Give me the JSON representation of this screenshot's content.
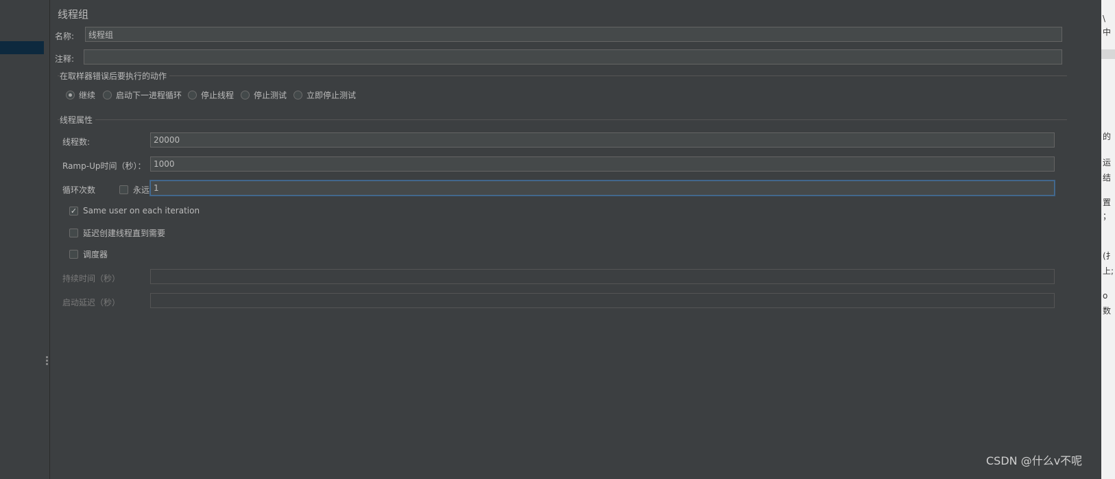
{
  "panel_title": "线程组",
  "name_field": {
    "label": "名称:",
    "value": "线程组"
  },
  "comment_field": {
    "label": "注释:",
    "value": ""
  },
  "error_action": {
    "title": "在取样器错误后要执行的动作",
    "options": [
      {
        "label": "继续",
        "selected": true
      },
      {
        "label": "启动下一进程循环",
        "selected": false
      },
      {
        "label": "停止线程",
        "selected": false
      },
      {
        "label": "停止测试",
        "selected": false
      },
      {
        "label": "立即停止测试",
        "selected": false
      }
    ]
  },
  "thread_props": {
    "title": "线程属性",
    "threads": {
      "label": "线程数:",
      "value": "20000"
    },
    "rampup": {
      "label": "Ramp-Up时间（秒）：",
      "value": "1000"
    },
    "loop": {
      "label": "循环次数",
      "forever_label": "永远",
      "forever_checked": false,
      "value": "1"
    },
    "same_user": {
      "label": "Same user on each iteration",
      "checked": true
    },
    "delay_create": {
      "label": "延迟创建线程直到需要",
      "checked": false
    },
    "scheduler": {
      "label": "调度器",
      "checked": false
    },
    "duration": {
      "label": "持续时间（秒）",
      "value": ""
    },
    "startup_delay": {
      "label": "启动延迟（秒）",
      "value": ""
    }
  },
  "right_edge_fragments": [
    "\\",
    "中",
    "的",
    "运",
    "结",
    "置",
    "；",
    "(扌",
    "上;",
    "o",
    "数"
  ],
  "watermark": "CSDN @什么v不呢",
  "colors": {
    "background": "#3c3f41",
    "field_bg": "#45494a",
    "focus_border": "#466d94",
    "tree_selection": "#0d293e"
  }
}
